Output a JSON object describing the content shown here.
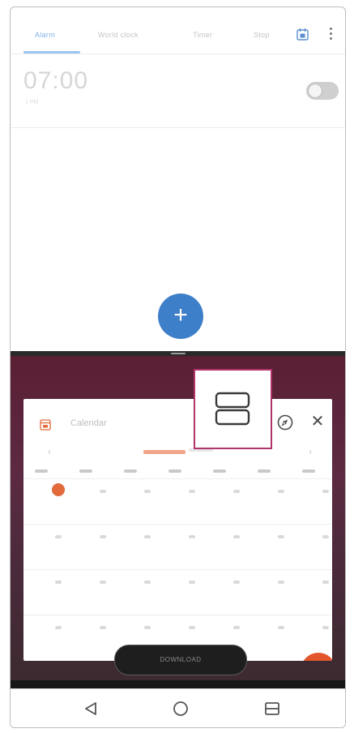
{
  "top_app": {
    "tabs": [
      {
        "label": "Alarm",
        "active": true
      },
      {
        "label": "World clock",
        "active": false
      },
      {
        "label": "Timer",
        "active": false
      },
      {
        "label": "Stop",
        "active": false
      }
    ],
    "calendar_icon": "calendar-icon",
    "menu_icon": "more-vert-icon",
    "alarm": {
      "time": "07:00",
      "sub": "1 PM",
      "enabled": false
    },
    "fab_label": "+",
    "colors": {
      "accent": "#3e7fc9",
      "tab_active": "#7fb1e4"
    }
  },
  "bottom_app": {
    "title": "Calendar",
    "app_icon": "calendar-icon",
    "prev_arrow": "‹",
    "next_arrow": "›",
    "compass_icon": "compass-icon",
    "close_label": "✕",
    "pill_label": "DOWNLOAD",
    "split_screen_icon": "split-screen-icon",
    "colors": {
      "today": "#e36a3b",
      "highlight_border": "#b1336b",
      "fab": "#e3562c"
    }
  },
  "nav": {
    "back_icon": "back-triangle-icon",
    "home_icon": "home-circle-icon",
    "recents_icon": "split-recents-icon"
  }
}
